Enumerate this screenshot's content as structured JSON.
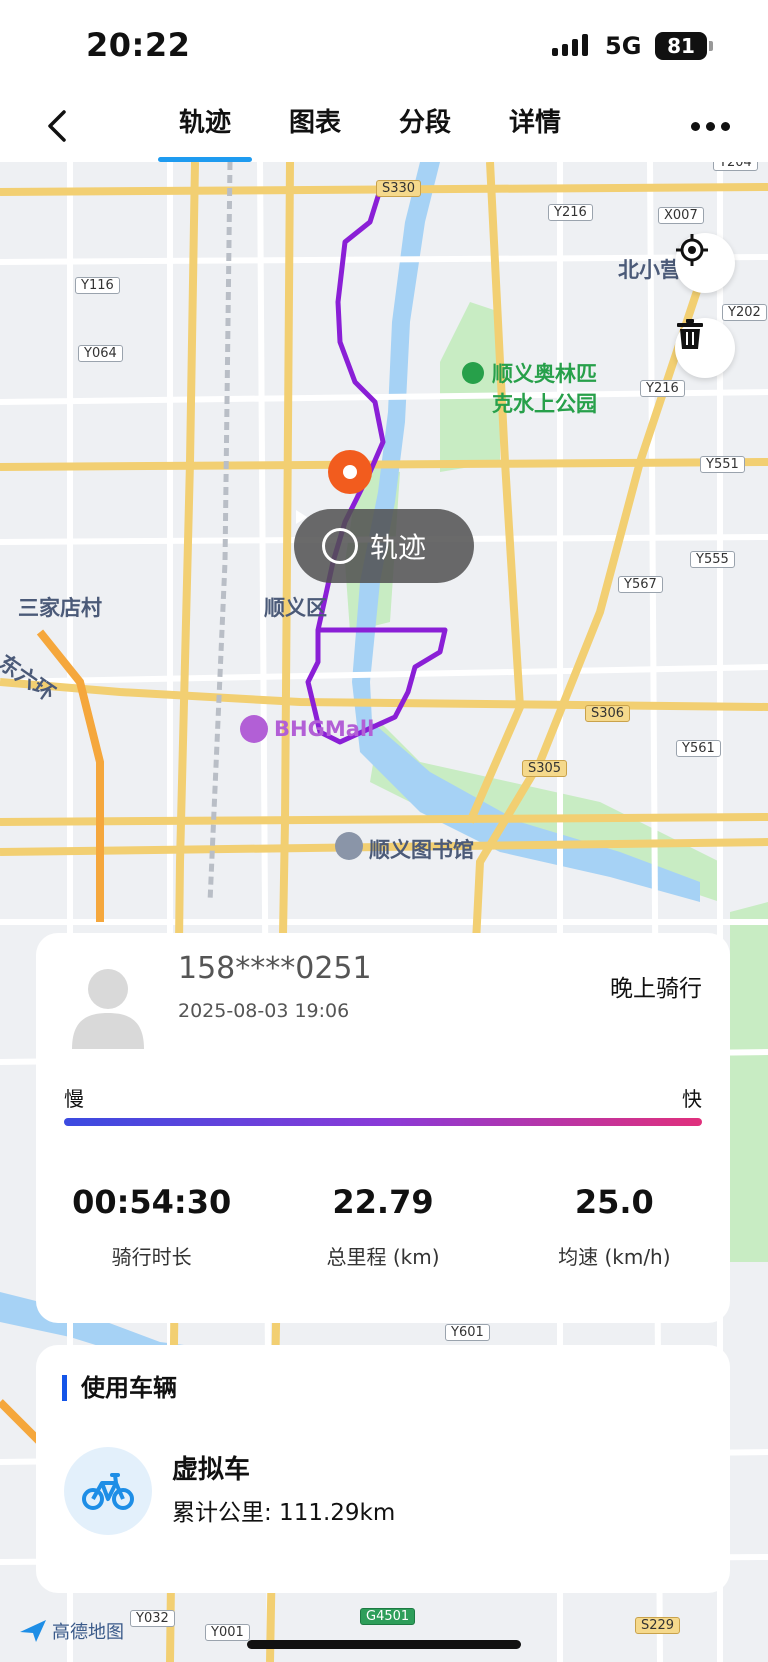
{
  "status_bar": {
    "time": "20:22",
    "network": "5G",
    "battery": "81"
  },
  "nav": {
    "tabs": [
      {
        "label": "轨迹",
        "active": true
      },
      {
        "label": "图表",
        "active": false
      },
      {
        "label": "分段",
        "active": false
      },
      {
        "label": "详情",
        "active": false
      }
    ],
    "back_icon": "chevron-left-icon",
    "more_icon": "more-dots-icon"
  },
  "map": {
    "play_button_label": "轨迹",
    "road_labels": [
      "S330",
      "Y204",
      "Y216",
      "X007",
      "Y116",
      "Y064",
      "Y202",
      "Y216",
      "Y551",
      "Y555",
      "Y567",
      "S306",
      "Y561",
      "S305",
      "Y601",
      "Y032",
      "Y001",
      "G4501",
      "S229"
    ],
    "places": [
      "北小营",
      "顺义奥林匹",
      "克水上公园",
      "三家店村",
      "顺义区",
      "东六环",
      "BHGMall",
      "顺义图书馆"
    ],
    "route_color": "#8a1fd6",
    "brand": "高德地图"
  },
  "ride": {
    "user": "158****0251",
    "datetime": "2025-08-03 19:06",
    "name": "晚上骑行",
    "speed_scale": {
      "slow": "慢",
      "fast": "快"
    },
    "stats": [
      {
        "value": "00:54:30",
        "label": "骑行时长"
      },
      {
        "value": "22.79",
        "label": "总里程 (km)"
      },
      {
        "value": "25.0",
        "label": "均速 (km/h)"
      }
    ]
  },
  "vehicle": {
    "section_title": "使用车辆",
    "name": "虚拟车",
    "total": "累计公里: 111.29km"
  }
}
